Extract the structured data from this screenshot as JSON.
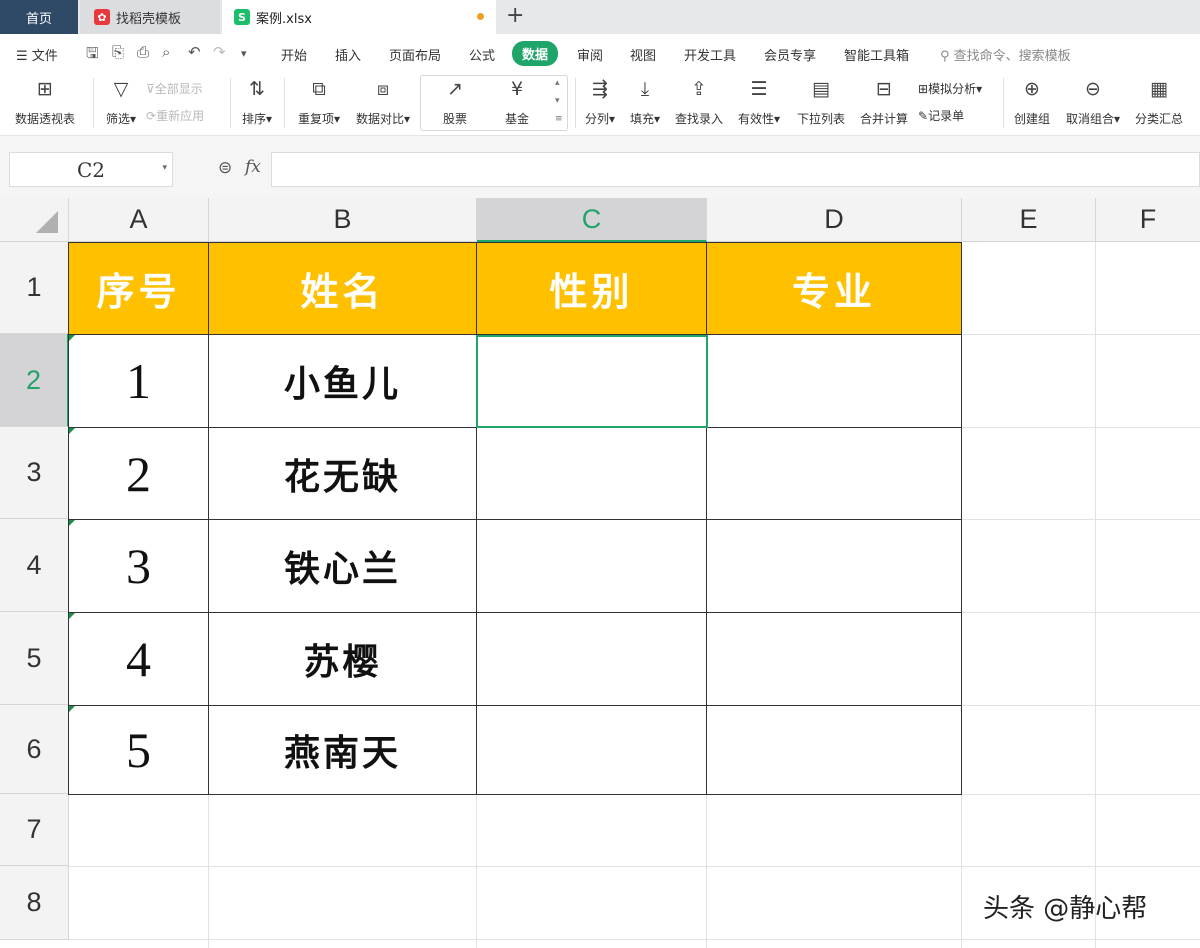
{
  "tabs": {
    "home": "首页",
    "template": "找稻壳模板",
    "file": "案例.xlsx",
    "new_tab": "+"
  },
  "menu": {
    "file": "文件",
    "items": [
      "开始",
      "插入",
      "页面布局",
      "公式",
      "数据",
      "审阅",
      "视图",
      "开发工具",
      "会员专享",
      "智能工具箱"
    ],
    "active": "数据",
    "search_placeholder": "查找命令、搜索模板"
  },
  "ribbon": {
    "pivot": "数据透视表",
    "filter": "筛选",
    "show_all": "全部显示",
    "reapply": "重新应用",
    "sort": "排序",
    "duplicates": "重复项",
    "compare": "数据对比",
    "stock": "股票",
    "fund": "基金",
    "split": "分列",
    "fill": "填充",
    "lookup_entry": "查找录入",
    "validity": "有效性",
    "dropdown_list": "下拉列表",
    "consolidate": "合并计算",
    "what_if": "模拟分析",
    "record_sheet": "记录单",
    "group": "创建组",
    "ungroup": "取消组合",
    "subtotal": "分类汇总"
  },
  "formula_bar": {
    "cell_ref": "C2",
    "fx": "fx",
    "value": ""
  },
  "columns": [
    "A",
    "B",
    "C",
    "D",
    "E",
    "F"
  ],
  "selected_column": "C",
  "rows": [
    "1",
    "2",
    "3",
    "4",
    "5",
    "6",
    "7",
    "8"
  ],
  "selected_row": "2",
  "table": {
    "headers": [
      "序号",
      "姓名",
      "性别",
      "专业"
    ],
    "records": [
      {
        "no": "1",
        "name": "小鱼儿",
        "gender": "",
        "major": ""
      },
      {
        "no": "2",
        "name": "花无缺",
        "gender": "",
        "major": ""
      },
      {
        "no": "3",
        "name": "铁心兰",
        "gender": "",
        "major": ""
      },
      {
        "no": "4",
        "name": "苏樱",
        "gender": "",
        "major": ""
      },
      {
        "no": "5",
        "name": "燕南天",
        "gender": "",
        "major": ""
      }
    ]
  },
  "colors": {
    "accent": "#1fa46a",
    "header_fill": "#ffc000",
    "home_tab": "#2f4a66"
  },
  "watermark": "头条 @静心帮"
}
